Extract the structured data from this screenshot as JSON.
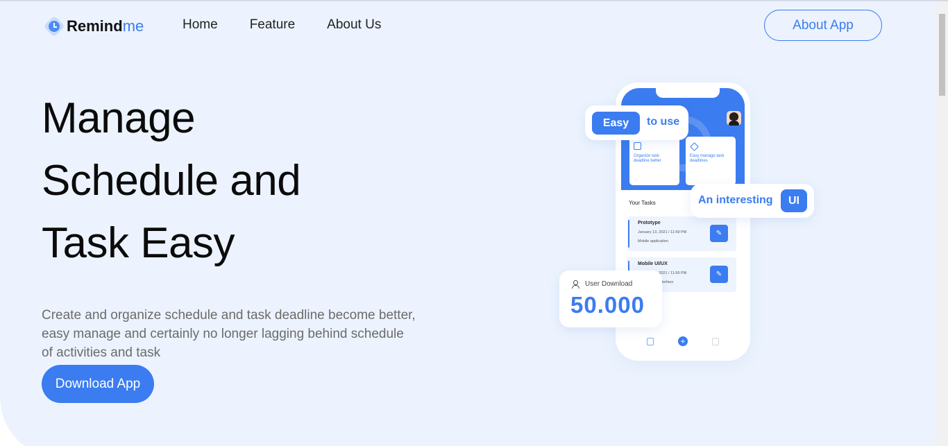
{
  "brand": {
    "name_main": "Remind",
    "name_accent": "me"
  },
  "nav": {
    "items": [
      "Home",
      "Feature",
      "About Us"
    ],
    "cta": "About App"
  },
  "hero": {
    "headline": [
      "Manage",
      "Schedule and",
      "Task Easy"
    ],
    "description": "Create and organize schedule and task deadline become better, easy manage and certainly no longer lagging behind schedule of activities and task",
    "button": "Download App"
  },
  "phone": {
    "cards": [
      "Organize task deadline better",
      "Easy manage task deadlines"
    ],
    "section_title": "Your Tasks",
    "tasks": [
      {
        "name": "Prototype",
        "date": "January 13, 2021 / 11:59 PM",
        "sub": "Mobile application"
      },
      {
        "name": "Mobile UI/UX",
        "date": "January 10, 2021 / 11:59 PM",
        "sub": "Onboarding interface"
      }
    ]
  },
  "badges": {
    "easy_pill": "Easy",
    "easy_rest": "to use",
    "ui_rest": "An interesting",
    "ui_pill": "UI",
    "download_label": "User Download",
    "download_count": "50.000"
  },
  "colors": {
    "accent": "#3b7cf0",
    "hero_bg": "#ecf3fe",
    "text_dark": "#0b0b0b",
    "text_muted": "#6b6b6b"
  },
  "icons": [
    "clock-logo-icon",
    "calendar-icon",
    "layers-icon",
    "edit-icon",
    "user-icon",
    "clipboard-icon",
    "plus-icon"
  ]
}
